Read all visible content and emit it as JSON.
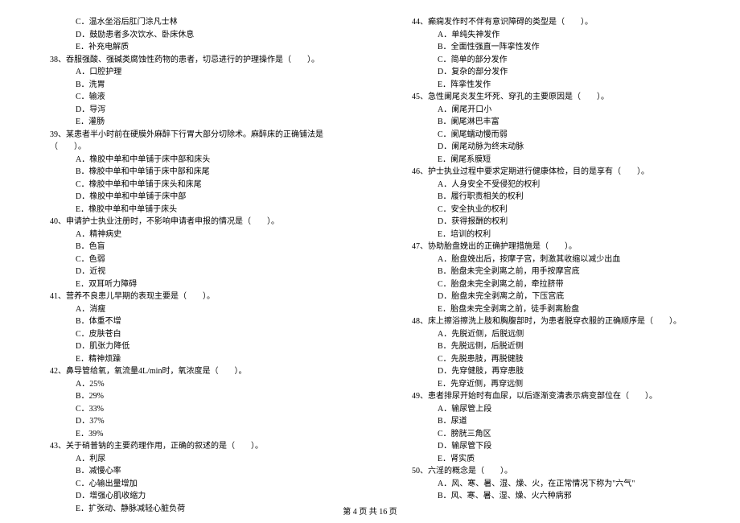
{
  "left": {
    "pre_options": [
      "C．温水坐浴后肛门涂凡士林",
      "D．鼓励患者多次饮水、卧床休息",
      "E．补充电解质"
    ],
    "q38": {
      "text": "38、吞服强酸、强碱类腐蚀性药物的患者，切忌进行的护理操作是（　　）。",
      "opts": [
        "A．口腔护理",
        "B．洗胃",
        "C．输液",
        "D．导泻",
        "E．灌肠"
      ]
    },
    "q39": {
      "text": "39、某患者半小时前在硬膜外麻醉下行胃大部分切除术。麻醉床的正确铺法是（　　）。",
      "opts": [
        "A．橡胶中单和中单铺于床中部和床头",
        "B．橡胶中单和中单铺于床中部和床尾",
        "C．橡胶中单和中单铺于床头和床尾",
        "D．橡胶中单和中单铺于床中部",
        "E．橡胶中单和中单铺于床头"
      ]
    },
    "q40": {
      "text": "40、申请护士执业注册时，不影响申请者申报的情况是（　　）。",
      "opts": [
        "A．精神病史",
        "B．色盲",
        "C．色弱",
        "D．近视",
        "E．双耳听力障碍"
      ]
    },
    "q41": {
      "text": "41、营养不良患儿早期的表现主要是（　　）。",
      "opts": [
        "A．消瘦",
        "B．体重不增",
        "C．皮肤苍白",
        "D．肌张力降低",
        "E．精神烦躁"
      ]
    },
    "q42": {
      "text": "42、鼻导管给氧，氧流量4L/min时，氧浓度是（　　）。",
      "opts": [
        "A．25%",
        "B．29%",
        "C．33%",
        "D．37%",
        "E．39%"
      ]
    },
    "q43": {
      "text": "43、关于硝普钠的主要药理作用，正确的叙述的是（　　）。",
      "opts": [
        "A．利尿",
        "B．减慢心率",
        "C．心输出量增加",
        "D．增强心肌收缩力",
        "E．扩张动、静脉减轻心脏负荷"
      ]
    }
  },
  "right": {
    "q44": {
      "text": "44、癫痫发作时不伴有意识障碍的类型是（　　）。",
      "opts": [
        "A．单纯失神发作",
        "B．全面性强直一阵挛性发作",
        "C．简单的部分发作",
        "D．复杂的部分发作",
        "E．阵挛性发作"
      ]
    },
    "q45": {
      "text": "45、急性阑尾炎发生坏死、穿孔的主要原因是（　　）。",
      "opts": [
        "A．阑尾开口小",
        "B．阑尾淋巴丰富",
        "C．阑尾蠕动慢而弱",
        "D．阑尾动脉为终末动脉",
        "E．阑尾系膜短"
      ]
    },
    "q46": {
      "text": "46、护士执业过程中要求定期进行健康体检，目的是享有（　　）。",
      "opts": [
        "A．人身安全不受侵犯的权利",
        "B．履行职责相关的权利",
        "C．安全执业的权利",
        "D．获得报酬的权利",
        "E．培训的权利"
      ]
    },
    "q47": {
      "text": "47、协助胎盘娩出的正确护理措施是（　　）。",
      "opts": [
        "A．胎盘娩出后，按摩子宫，刺激其收缩以减少出血",
        "B．胎盘未完全剥离之前，用手按摩宫底",
        "C．胎盘未完全剥离之前，牵拉脐带",
        "D．胎盘未完全剥离之前，下压宫底",
        "E．胎盘未完全剥离之前，徒手剥离胎盘"
      ]
    },
    "q48": {
      "text": "48、床上擦浴擦洗上肢和胸腹部时，为患者脱穿衣服的正确顺序是（　　）。",
      "opts": [
        "A．先脱近侧，后脱远侧",
        "B．先脱远侧，后脱近侧",
        "C．先脱患肢，再脱健肢",
        "D．先穿健肢，再穿患肢",
        "E．先穿近侧，再穿远侧"
      ]
    },
    "q49": {
      "text": "49、患者排尿开始时有血尿，以后逐渐变清表示病变部位在（　　）。",
      "opts": [
        "A．输尿管上段",
        "B．尿道",
        "C．膀胱三角区",
        "D．输尿管下段",
        "E．肾实质"
      ]
    },
    "q50": {
      "text": "50、六淫的概念是（　　）。",
      "opts": [
        "A．风、寒、暑、湿、燥、火，在正常情况下称为\"六气\"",
        "B．风、寒、暑、湿、燥、火六种病邪"
      ]
    }
  },
  "footer": "第 4 页 共 16 页"
}
